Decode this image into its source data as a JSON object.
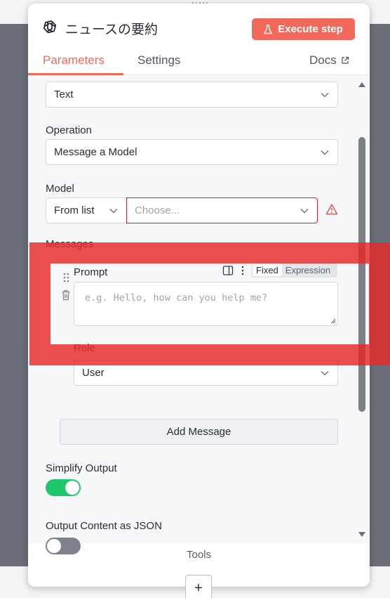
{
  "node": {
    "title": "ニュースの要約",
    "icon": "openai-icon"
  },
  "header": {
    "execute_label": "Execute step"
  },
  "tabs": {
    "parameters": "Parameters",
    "settings": "Settings",
    "docs": "Docs"
  },
  "fields": {
    "resource_value": "Text",
    "operation_label": "Operation",
    "operation_value": "Message a Model",
    "model_label": "Model",
    "model_mode": "From list",
    "model_placeholder": "Choose...",
    "messages_label": "Messages",
    "prompt_label": "Prompt",
    "prompt_mode_fixed": "Fixed",
    "prompt_mode_expression": "Expression",
    "prompt_placeholder": "e.g. Hello, how can you help me?",
    "role_label": "Role",
    "role_value": "User",
    "add_message": "Add Message",
    "simplify_label": "Simplify Output",
    "simplify_on": true,
    "json_label": "Output Content as JSON",
    "json_on": false
  },
  "footer": {
    "tools_label": "Tools",
    "add_label": "+"
  },
  "colors": {
    "accent": "#ee6a5a",
    "execute_bg": "#f2685a",
    "switch_on": "#1ec86a",
    "highlight": "#e62828",
    "error_border": "#c7243a"
  }
}
